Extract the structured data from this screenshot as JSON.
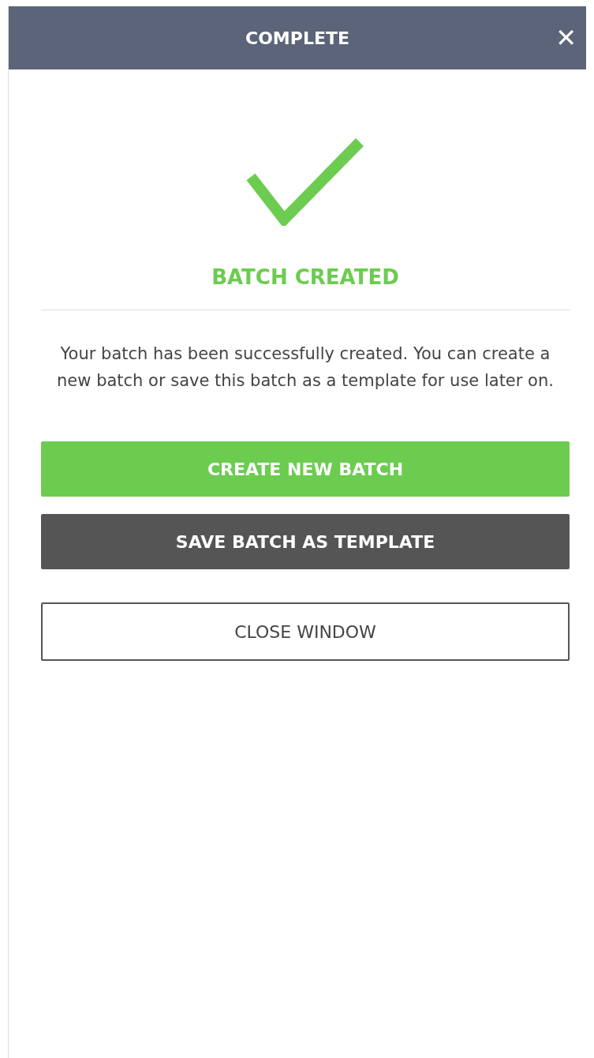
{
  "header": {
    "title": "COMPLETE",
    "close": "✕"
  },
  "status": {
    "title": "BATCH CREATED",
    "message": "Your batch has been successfully created. You can create a new batch or save this batch as a template for use later on."
  },
  "buttons": [
    {
      "label": "CREATE NEW BATCH",
      "kind": "primary"
    },
    {
      "label": "SAVE BATCH AS TEMPLATE",
      "kind": "secondary"
    },
    {
      "label": "CLOSE WINDOW",
      "kind": "outline"
    }
  ]
}
